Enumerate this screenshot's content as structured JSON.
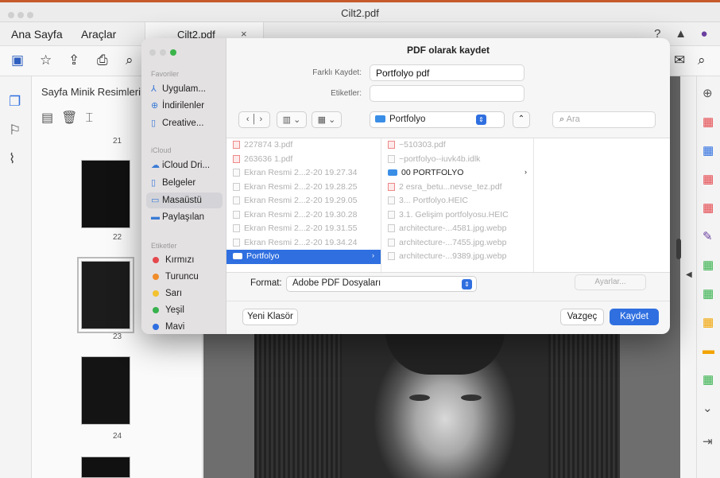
{
  "window": {
    "title": "Cilt2.pdf"
  },
  "menu": {
    "home": "Ana Sayfa",
    "tools": "Araçlar"
  },
  "tab": {
    "label": "Cilt2.pdf",
    "close": "×"
  },
  "topbar_icons": [
    "help-icon",
    "bell-icon",
    "account-icon"
  ],
  "toolbar_icons": [
    "save-icon",
    "bookmark-star-icon",
    "upload-icon",
    "print-icon",
    "zoom-icon"
  ],
  "thumbnail_panel": {
    "title": "Sayfa Minik Resimleri",
    "pages": [
      {
        "num": "21"
      },
      {
        "num": "22"
      },
      {
        "num": "23"
      },
      {
        "num": "24"
      }
    ]
  },
  "dialog": {
    "title": "PDF olarak kaydet",
    "save_as_label": "Farklı Kaydet:",
    "save_as_value": "Portfolyo pdf",
    "tags_label": "Etiketler:",
    "tags_value": "",
    "location": "Portfolyo",
    "search_placeholder": "Ara",
    "sidebar": {
      "favorites_header": "Favoriler",
      "favorites": [
        "Uygulam...",
        "İndirilenler",
        "Creative..."
      ],
      "icloud_header": "iCloud",
      "icloud": [
        "iCloud Dri...",
        "Belgeler",
        "Masaüstü",
        "Paylaşılan"
      ],
      "tags_header": "Etiketler",
      "tags": [
        {
          "label": "Kırmızı",
          "color": "#e5484d"
        },
        {
          "label": "Turuncu",
          "color": "#f08c2a"
        },
        {
          "label": "Sarı",
          "color": "#f2c230"
        },
        {
          "label": "Yeşil",
          "color": "#37b24d"
        },
        {
          "label": "Mavi",
          "color": "#2f6fe0"
        }
      ]
    },
    "col1": [
      {
        "name": "227874 3.pdf",
        "kind": "pdf"
      },
      {
        "name": "263636 1.pdf",
        "kind": "pdf"
      },
      {
        "name": "Ekran Resmi 2...2-20 19.27.34",
        "kind": "img"
      },
      {
        "name": "Ekran Resmi 2...2-20 19.28.25",
        "kind": "img"
      },
      {
        "name": "Ekran Resmi 2...2-20 19.29.05",
        "kind": "img"
      },
      {
        "name": "Ekran Resmi 2...2-20 19.30.28",
        "kind": "img"
      },
      {
        "name": "Ekran Resmi 2...2-20 19.31.55",
        "kind": "img"
      },
      {
        "name": "Ekran Resmi 2...2-20 19.34.24",
        "kind": "img"
      },
      {
        "name": "Portfolyo",
        "kind": "dir"
      }
    ],
    "col2": [
      {
        "name": "~510303.pdf",
        "kind": "pdf"
      },
      {
        "name": "~portfolyo--iuvk4b.idlk",
        "kind": "doc"
      },
      {
        "name": "00 PORTFOLYO",
        "kind": "dir"
      },
      {
        "name": "2 esra_betu...nevse_tez.pdf",
        "kind": "pdf"
      },
      {
        "name": "3... Portfolyo.HEIC",
        "kind": "img"
      },
      {
        "name": "3.1. Gelişim portfolyosu.HEIC",
        "kind": "img"
      },
      {
        "name": "architecture-...4581.jpg.webp",
        "kind": "img"
      },
      {
        "name": "architecture-...7455.jpg.webp",
        "kind": "img"
      },
      {
        "name": "architecture-...9389.jpg.webp",
        "kind": "img"
      }
    ],
    "format_label": "Format:",
    "format_value": "Adobe PDF Dosyaları",
    "options_button": "Ayarlar...",
    "new_folder_button": "Yeni Klasör",
    "cancel_button": "Vazgeç",
    "save_button": "Kaydet"
  }
}
